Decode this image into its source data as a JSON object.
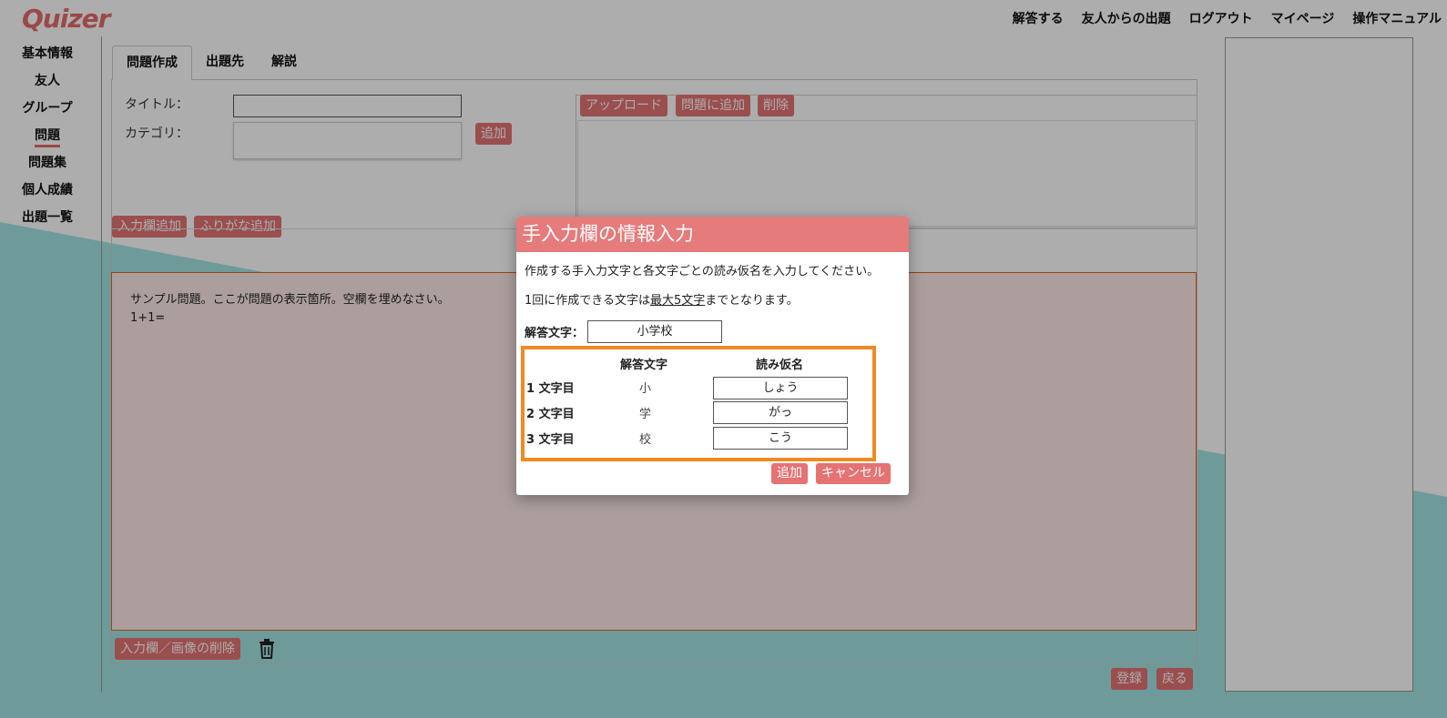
{
  "app": {
    "logo": "Quizer"
  },
  "topnav": [
    "解答する",
    "友人からの出題",
    "ログアウト",
    "マイページ",
    "操作マニュアル"
  ],
  "sidebar": {
    "items": [
      {
        "label": "基本情報"
      },
      {
        "label": "友人"
      },
      {
        "label": "グループ"
      },
      {
        "label": "問題",
        "active": true
      },
      {
        "label": "問題集"
      },
      {
        "label": "個人成績"
      },
      {
        "label": "出題一覧"
      }
    ]
  },
  "tabs": [
    {
      "label": "問題作成",
      "active": true
    },
    {
      "label": "出題先"
    },
    {
      "label": "解説"
    }
  ],
  "form": {
    "title_label": "タイトル：",
    "title_value": "",
    "category_label": "カテゴリ：",
    "category_add": "追加",
    "upload": "アップロード",
    "add_to_question": "問題に追加",
    "delete": "削除",
    "add_input": "入力欄追加",
    "add_furigana": "ふりがな追加",
    "question_lines": [
      "サンプル問題。ここが問題の表示箇所。空欄を埋めなさい。",
      "1+1="
    ],
    "delete_input_image": "入力欄／画像の削除",
    "register": "登録",
    "back": "戻る"
  },
  "modal": {
    "title": "手入力欄の情報入力",
    "desc1": "作成する手入力文字と各文字ごとの読み仮名を入力してください。",
    "desc2_prefix": "1回に作成できる文字は",
    "desc2_link": "最大5文字",
    "desc2_suffix": "までとなります。",
    "answer_label": "解答文字：",
    "answer_value": "小学校",
    "col_char": "解答文字",
    "col_reading": "読み仮名",
    "rows": [
      {
        "label": "1 文字目",
        "char": "小",
        "reading": "しょう"
      },
      {
        "label": "2 文字目",
        "char": "学",
        "reading": "がっ"
      },
      {
        "label": "3 文字目",
        "char": "校",
        "reading": "こう"
      }
    ],
    "add_button": "追加",
    "cancel_button": "キャンセル"
  },
  "colors": {
    "accent": "#e57373",
    "highlight": "#f08a24",
    "teal": "#4a9e9e"
  }
}
